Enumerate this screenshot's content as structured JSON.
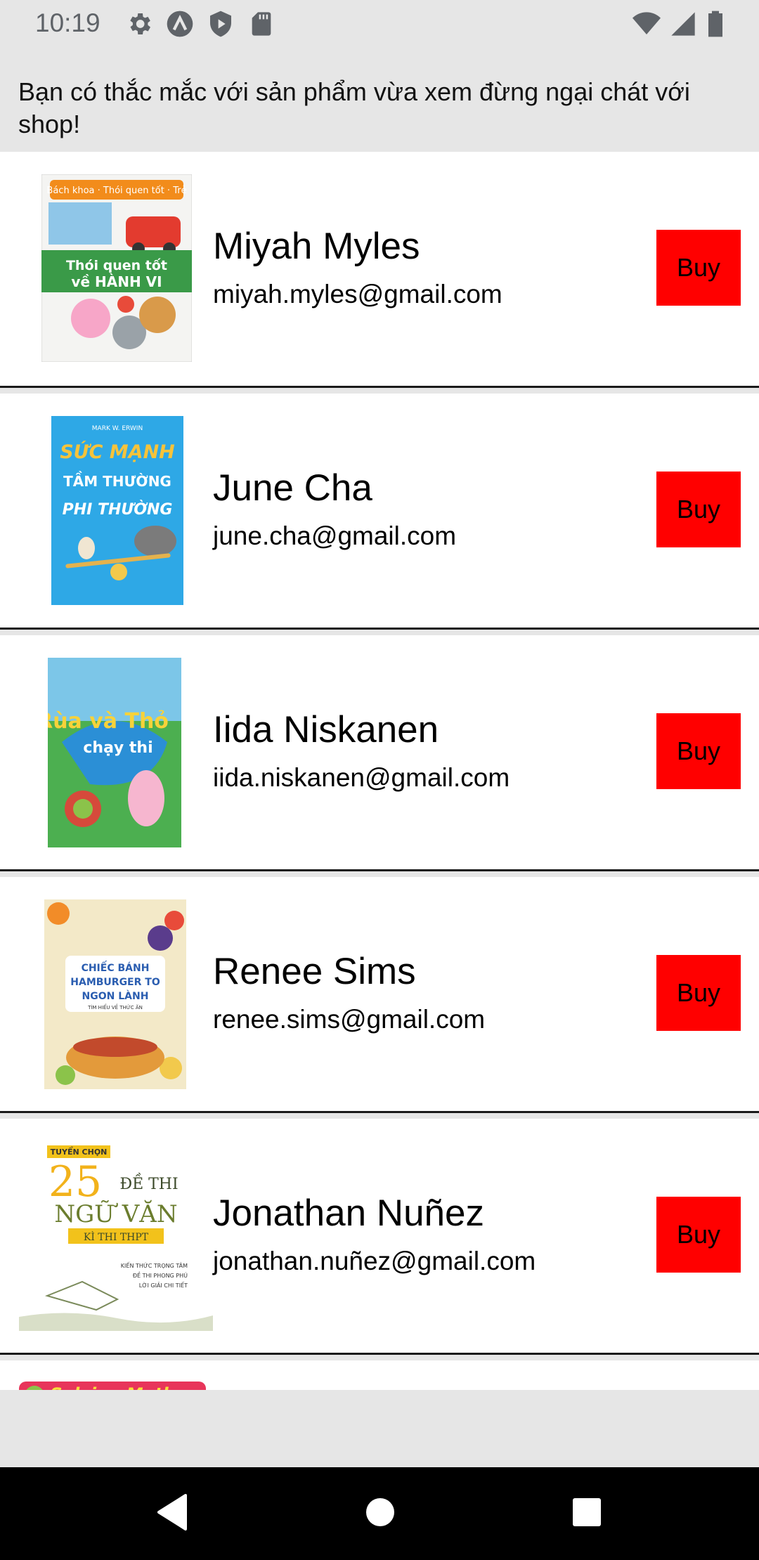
{
  "status_bar": {
    "time": "10:19",
    "left_icons": [
      "gear-icon",
      "autofill-icon",
      "play-protect-icon",
      "sd-card-icon"
    ],
    "right_icons": [
      "wifi-icon",
      "cell-signal-icon",
      "battery-icon"
    ]
  },
  "banner": {
    "text": "Bạn có thắc mắc với sản phẩm vừa xem đừng ngại chát với shop!"
  },
  "items": [
    {
      "name": "Miyah Myles",
      "email": "miyah.myles@gmail.com",
      "buy_label": "Buy",
      "cover": {
        "lines": [
          "Bách khoa · Thói quen tốt · Trẻ",
          "Thói quen tốt",
          "về HÀNH VI"
        ]
      }
    },
    {
      "name": "June Cha",
      "email": "june.cha@gmail.com",
      "buy_label": "Buy",
      "cover": {
        "lines": [
          "MARK W. ERWIN",
          "SỨC MẠNH",
          "TẦM THƯỜNG",
          "PHI THƯỜNG"
        ]
      }
    },
    {
      "name": "Iida Niskanen",
      "email": "iida.niskanen@gmail.com",
      "buy_label": "Buy",
      "cover": {
        "lines": [
          "Rùa và Thỏ",
          "chạy thi"
        ]
      }
    },
    {
      "name": "Renee Sims",
      "email": "renee.sims@gmail.com",
      "buy_label": "Buy",
      "cover": {
        "lines": [
          "CHIẾC BÁNH",
          "HAMBURGER TO",
          "NGON LÀNH",
          "TÌM HIỂU VỀ THỨC ĂN"
        ]
      }
    },
    {
      "name": "Jonathan Nuñez",
      "email": "jonathan.nuñez@gmail.com",
      "buy_label": "Buy",
      "cover": {
        "lines": [
          "TUYỂN CHỌN",
          "25",
          "ĐỀ THI",
          "NGỮ VĂN",
          "KÌ THI THPT",
          "KIẾN THỨC TRỌNG TÂM",
          "ĐỀ THI PHONG PHÚ",
          "LỜI GIẢI CHI TIẾT"
        ]
      }
    }
  ],
  "partial_item": {
    "cover": {
      "lines": [
        "Solving Maths"
      ]
    }
  },
  "nav_bar": {
    "buttons": [
      "back-icon",
      "home-icon",
      "recents-icon"
    ]
  }
}
